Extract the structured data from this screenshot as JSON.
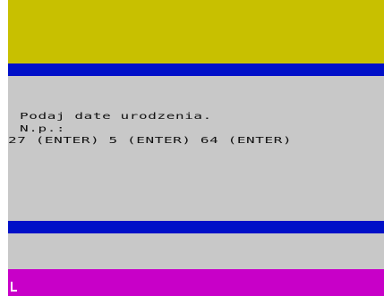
{
  "colors": {
    "border": "#c8c000",
    "accent_blue": "#0010c8",
    "paper": "#c8c8c8",
    "lower_border": "#c800c8",
    "ink": "#111111"
  },
  "prompt": {
    "line1": "Podaj date urodzenia.",
    "line2": "N.p.:",
    "line3": "27 (ENTER) 5 (ENTER) 64 (ENTER)"
  },
  "cursor": {
    "glyph": "L",
    "icon": "cursor-icon"
  }
}
